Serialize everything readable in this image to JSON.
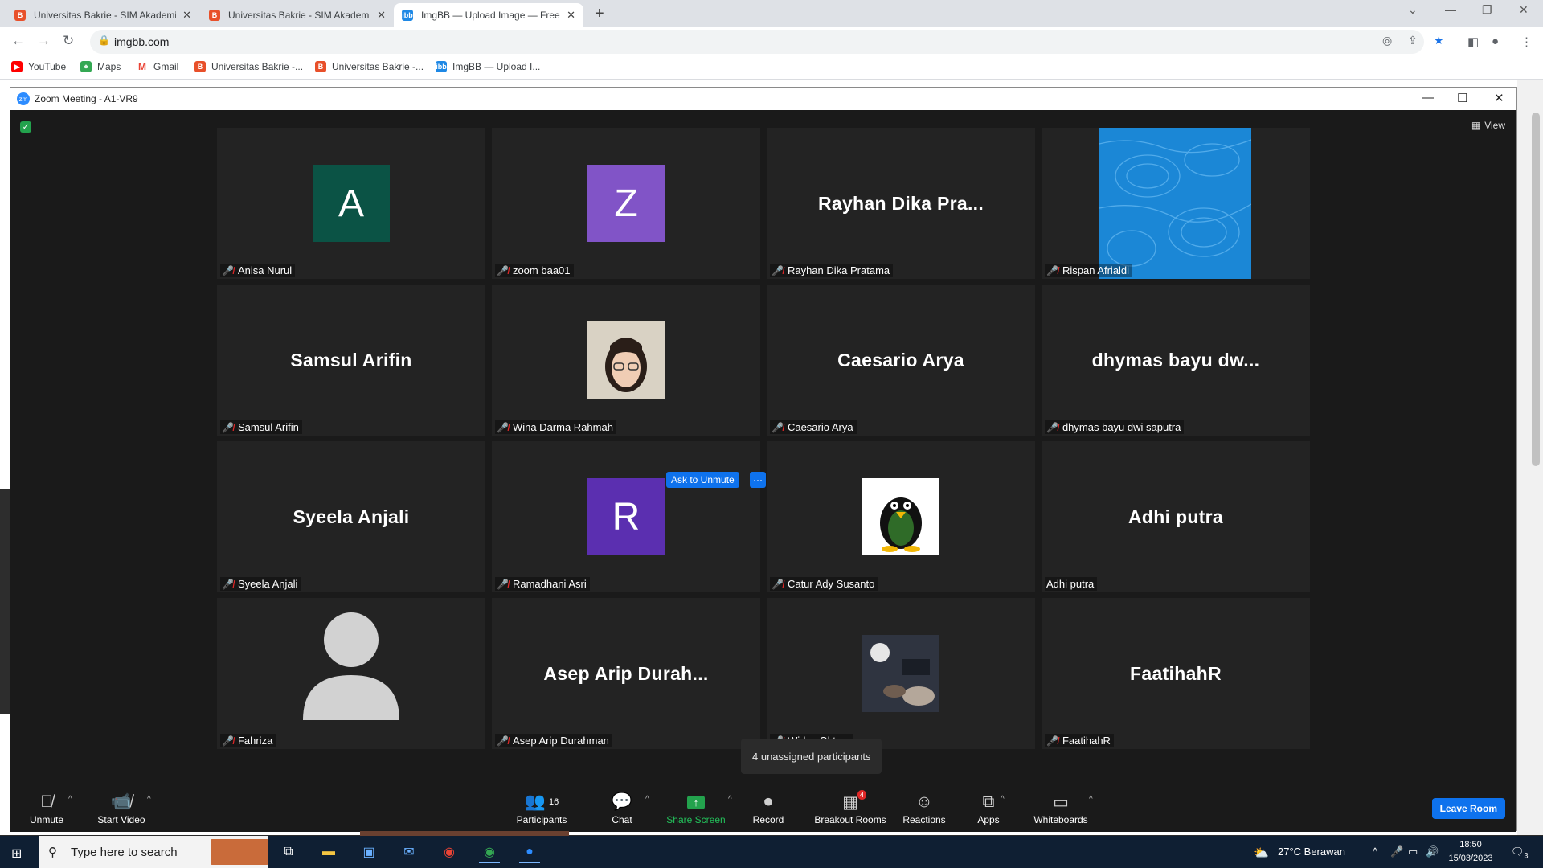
{
  "browser": {
    "tabs": [
      {
        "title": "Universitas Bakrie - SIM Akademik"
      },
      {
        "title": "Universitas Bakrie - SIM Akademik"
      },
      {
        "title": "ImgBB — Upload Image — Free"
      }
    ],
    "url": "imgbb.com",
    "bookmarks": [
      {
        "label": "YouTube"
      },
      {
        "label": "Maps"
      },
      {
        "label": "Gmail"
      },
      {
        "label": "Universitas Bakrie -..."
      },
      {
        "label": "Universitas Bakrie -..."
      },
      {
        "label": "ImgBB — Upload I..."
      }
    ]
  },
  "zoom": {
    "window_title": "Zoom Meeting - A1-VR9",
    "view_label": "View",
    "tiles": [
      {
        "display": "A",
        "label": "Anisa Nurul",
        "muted": true,
        "avatar_color": "#0b5345"
      },
      {
        "display": "Z",
        "label": "zoom baa01",
        "muted": true,
        "avatar_color": "#8154c7"
      },
      {
        "display": "Rayhan Dika Pra...",
        "label": "Rayhan Dika Pratama",
        "muted": true
      },
      {
        "display": "",
        "label": "Rispan Afrialdi",
        "muted": true
      },
      {
        "display": "Samsul Arifin",
        "label": "Samsul Arifin",
        "muted": true
      },
      {
        "display": "",
        "label": "Wina Darma Rahmah",
        "muted": true
      },
      {
        "display": "Caesario Arya",
        "label": "Caesario Arya",
        "muted": true
      },
      {
        "display": "dhymas bayu dw...",
        "label": "dhymas bayu dwi saputra",
        "muted": true
      },
      {
        "display": "Syeela Anjali",
        "label": "Syeela Anjali",
        "muted": true
      },
      {
        "display": "R",
        "label": "Ramadhani Asri",
        "muted": true,
        "avatar_color": "#5b2fb0"
      },
      {
        "display": "",
        "label": "Catur Ady Susanto",
        "muted": true
      },
      {
        "display": "Adhi putra",
        "label": "Adhi putra",
        "muted": false
      },
      {
        "display": "",
        "label": "Fahriza",
        "muted": true
      },
      {
        "display": "Asep Arip Durah...",
        "label": "Asep Arip Durahman",
        "muted": true
      },
      {
        "display": "",
        "label": "Widya Okta...",
        "muted": true
      },
      {
        "display": "FaatihahR",
        "label": "FaatihahR",
        "muted": true
      }
    ],
    "ask_to_unmute": "Ask to Unmute",
    "more_label": "···",
    "unassigned": "4 unassigned participants",
    "toolbar": {
      "unmute": "Unmute",
      "start_video": "Start Video",
      "participants": "Participants",
      "participants_count": "16",
      "chat": "Chat",
      "share_screen": "Share Screen",
      "record": "Record",
      "breakout_rooms": "Breakout Rooms",
      "breakout_badge": "4",
      "reactions": "Reactions",
      "apps": "Apps",
      "whiteboards": "Whiteboards",
      "leave_room": "Leave Room"
    }
  },
  "taskbar": {
    "search_placeholder": "Type here to search",
    "weather": "27°C  Berawan",
    "time": "18:50",
    "date": "15/03/2023",
    "notifications": "3"
  }
}
